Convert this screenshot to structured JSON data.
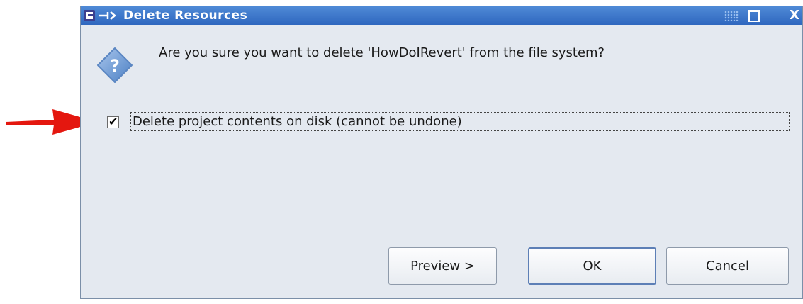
{
  "window": {
    "title": "Delete Resources",
    "close_glyph": "X",
    "icons": [
      "app-icon",
      "maximize-icon",
      "close-icon"
    ]
  },
  "dialog": {
    "message": "Are you sure you want to delete 'HowDoIRevert' from the file system?",
    "icon": "question-icon",
    "checkbox": {
      "label": "Delete project contents on disk (cannot be undone)",
      "checked": true
    },
    "buttons": {
      "preview": "Preview >",
      "ok": "OK",
      "cancel": "Cancel"
    }
  },
  "annotation": {
    "arrow_color": "#e4170f"
  },
  "colors": {
    "titlebar": "#3a74cc",
    "dialog_bg": "#e4e9f0",
    "default_button_border": "#5d7fb6"
  }
}
